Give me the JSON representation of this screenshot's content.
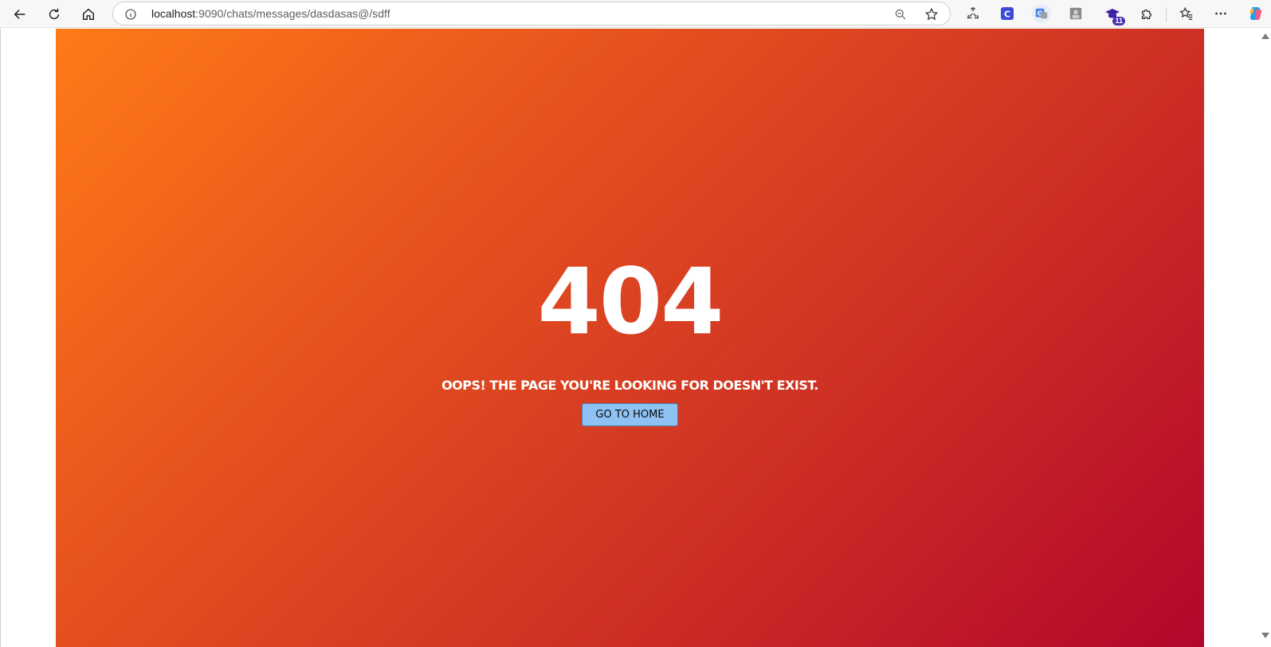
{
  "browser": {
    "url_host": "localhost",
    "url_rest": ":9090/chats/messages/dasdasas@/sdff",
    "icons": {
      "back": "back-arrow-icon",
      "refresh": "refresh-icon",
      "home": "home-icon",
      "info": "info-icon",
      "zoom": "zoom-out-icon",
      "favorite": "star-icon",
      "extensions_menu": "puzzle-icon",
      "favorites_bar": "favorites-icon",
      "more": "more-icon",
      "copilot": "copilot-icon"
    },
    "extension_badge": "11"
  },
  "page": {
    "error_code": "404",
    "message": "OOPS! THE PAGE YOU'RE LOOKING FOR DOESN'T EXIST.",
    "home_button_label": "GO TO HOME",
    "colors": {
      "gradient_start": "#ff7a17",
      "gradient_end": "#b3062c",
      "button_bg": "#8ec2f3"
    }
  }
}
